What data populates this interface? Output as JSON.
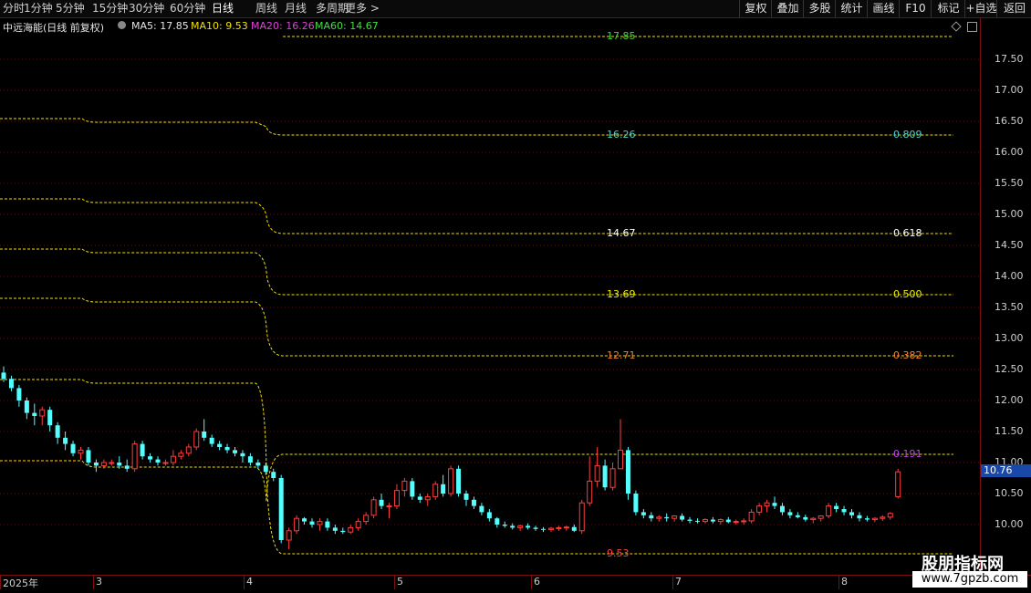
{
  "toolbar": {
    "periods": [
      "分时",
      "1分钟",
      "5分钟",
      "15分钟",
      "30分钟",
      "60分钟",
      "日线",
      "周线",
      "月线",
      "多周期",
      "更多 >"
    ],
    "active": "日线",
    "buttons": [
      "复权",
      "叠加",
      "多股",
      "统计",
      "画线",
      "F10",
      "+自选",
      "返回"
    ],
    "extra": "标记"
  },
  "info": {
    "stock": "中远海能(日线 前复权)",
    "ma5": "MA5: 17.85",
    "ma10": "MA10: 9.53",
    "ma20": "MA20: 16.26",
    "ma60": "MA60: 14.67",
    "ma_colors": {
      "ma5": "#e6e6e6",
      "ma10": "#f0e000",
      "ma20": "#e040e0",
      "ma60": "#40e040"
    }
  },
  "chart_data": {
    "type": "candlestick",
    "y_ticks": [
      "17.50",
      "17.00",
      "16.50",
      "16.00",
      "15.50",
      "15.00",
      "14.50",
      "14.00",
      "13.50",
      "13.00",
      "12.50",
      "12.00",
      "11.50",
      "11.00",
      "10.50",
      "10.00"
    ],
    "x_labels": [
      "2025年",
      "3",
      "4",
      "5",
      "6",
      "7",
      "8"
    ],
    "current_price": "10.76",
    "fib_levels": [
      {
        "price": "17.85",
        "ratio": "",
        "color": "#40d040"
      },
      {
        "price": "16.26",
        "ratio": "0.809",
        "color": "#50d0d0"
      },
      {
        "price": "14.67",
        "ratio": "0.618",
        "color": "#ffffff"
      },
      {
        "price": "13.69",
        "ratio": "0.500",
        "color": "#f0f000"
      },
      {
        "price": "12.71",
        "ratio": "0.382",
        "color": "#f08030"
      },
      {
        "price": "",
        "ratio": "0.191",
        "color": "#c040f0"
      },
      {
        "price": "9.53",
        "ratio": "",
        "color": "#ff4040"
      }
    ],
    "candles": [
      [
        12.45,
        12.55,
        12.3,
        12.35
      ],
      [
        12.35,
        12.4,
        12.15,
        12.2
      ],
      [
        12.2,
        12.25,
        11.9,
        12.0
      ],
      [
        12.0,
        12.05,
        11.7,
        11.8
      ],
      [
        11.8,
        11.95,
        11.6,
        11.75
      ],
      [
        11.75,
        11.9,
        11.6,
        11.85
      ],
      [
        11.85,
        11.9,
        11.5,
        11.6
      ],
      [
        11.6,
        11.65,
        11.3,
        11.4
      ],
      [
        11.4,
        11.5,
        11.2,
        11.3
      ],
      [
        11.3,
        11.35,
        11.1,
        11.15
      ],
      [
        11.15,
        11.25,
        11.05,
        11.2
      ],
      [
        11.2,
        11.25,
        10.95,
        11.0
      ],
      [
        11.0,
        11.05,
        10.85,
        10.95
      ],
      [
        10.95,
        11.05,
        10.9,
        11.0
      ],
      [
        11.0,
        11.05,
        10.95,
        11.0
      ],
      [
        11.0,
        11.1,
        10.9,
        10.95
      ],
      [
        10.95,
        11.05,
        10.85,
        10.9
      ],
      [
        10.9,
        11.35,
        10.85,
        11.3
      ],
      [
        11.3,
        11.35,
        11.05,
        11.1
      ],
      [
        11.1,
        11.15,
        11.0,
        11.05
      ],
      [
        11.05,
        11.1,
        10.95,
        11.0
      ],
      [
        11.0,
        11.05,
        10.95,
        11.0
      ],
      [
        11.0,
        11.2,
        10.95,
        11.1
      ],
      [
        11.1,
        11.2,
        11.05,
        11.15
      ],
      [
        11.15,
        11.3,
        11.1,
        11.25
      ],
      [
        11.25,
        11.55,
        11.2,
        11.5
      ],
      [
        11.5,
        11.7,
        11.35,
        11.4
      ],
      [
        11.4,
        11.45,
        11.25,
        11.3
      ],
      [
        11.3,
        11.35,
        11.2,
        11.25
      ],
      [
        11.25,
        11.3,
        11.15,
        11.2
      ],
      [
        11.2,
        11.25,
        11.1,
        11.15
      ],
      [
        11.15,
        11.2,
        11.0,
        11.1
      ],
      [
        11.1,
        11.15,
        10.95,
        11.0
      ],
      [
        11.0,
        11.05,
        10.9,
        10.95
      ],
      [
        10.95,
        11.0,
        10.8,
        10.85
      ],
      [
        10.85,
        10.9,
        10.7,
        10.75
      ],
      [
        10.75,
        10.8,
        9.7,
        9.75
      ],
      [
        9.75,
        9.95,
        9.6,
        9.9
      ],
      [
        9.9,
        10.15,
        9.85,
        10.1
      ],
      [
        10.1,
        10.12,
        10.0,
        10.05
      ],
      [
        10.05,
        10.1,
        9.95,
        10.0
      ],
      [
        10.0,
        10.1,
        9.9,
        10.05
      ],
      [
        10.05,
        10.1,
        9.9,
        9.95
      ],
      [
        9.95,
        10.0,
        9.85,
        9.9
      ],
      [
        9.9,
        9.95,
        9.85,
        9.88
      ],
      [
        9.88,
        10.0,
        9.85,
        9.95
      ],
      [
        9.95,
        10.1,
        9.9,
        10.05
      ],
      [
        10.05,
        10.2,
        10.0,
        10.15
      ],
      [
        10.15,
        10.45,
        10.1,
        10.4
      ],
      [
        10.4,
        10.5,
        10.25,
        10.3
      ],
      [
        10.3,
        10.35,
        10.1,
        10.3
      ],
      [
        10.3,
        10.65,
        10.25,
        10.55
      ],
      [
        10.55,
        10.75,
        10.45,
        10.7
      ],
      [
        10.7,
        10.75,
        10.4,
        10.45
      ],
      [
        10.45,
        10.5,
        10.35,
        10.4
      ],
      [
        10.4,
        10.5,
        10.3,
        10.45
      ],
      [
        10.45,
        10.7,
        10.4,
        10.65
      ],
      [
        10.65,
        10.8,
        10.45,
        10.5
      ],
      [
        10.5,
        10.95,
        10.45,
        10.9
      ],
      [
        10.9,
        10.95,
        10.45,
        10.5
      ],
      [
        10.5,
        10.55,
        10.3,
        10.4
      ],
      [
        10.4,
        10.45,
        10.25,
        10.3
      ],
      [
        10.3,
        10.35,
        10.15,
        10.2
      ],
      [
        10.2,
        10.25,
        10.05,
        10.1
      ],
      [
        10.1,
        10.12,
        9.95,
        10.0
      ],
      [
        10.0,
        10.05,
        9.95,
        9.98
      ],
      [
        9.98,
        10.02,
        9.92,
        9.95
      ],
      [
        9.95,
        10.0,
        9.9,
        9.98
      ],
      [
        9.98,
        10.02,
        9.92,
        9.95
      ],
      [
        9.95,
        9.98,
        9.9,
        9.93
      ],
      [
        9.93,
        9.96,
        9.88,
        9.92
      ],
      [
        9.92,
        9.96,
        9.88,
        9.94
      ],
      [
        9.94,
        9.98,
        9.9,
        9.95
      ],
      [
        9.95,
        9.98,
        9.9,
        9.96
      ],
      [
        9.96,
        10.0,
        9.88,
        9.9
      ],
      [
        9.9,
        10.4,
        9.85,
        10.35
      ],
      [
        10.35,
        11.1,
        10.3,
        10.7
      ],
      [
        10.7,
        11.25,
        10.6,
        10.95
      ],
      [
        10.95,
        11.05,
        10.55,
        10.6
      ],
      [
        10.6,
        11.0,
        10.55,
        10.9
      ],
      [
        10.9,
        11.7,
        10.9,
        11.2
      ],
      [
        11.2,
        11.25,
        10.4,
        10.5
      ],
      [
        10.5,
        10.55,
        10.15,
        10.2
      ],
      [
        10.2,
        10.25,
        10.1,
        10.15
      ],
      [
        10.15,
        10.2,
        10.05,
        10.1
      ],
      [
        10.1,
        10.15,
        10.05,
        10.12
      ],
      [
        10.12,
        10.18,
        10.05,
        10.1
      ],
      [
        10.1,
        10.15,
        10.05,
        10.14
      ],
      [
        10.14,
        10.18,
        10.05,
        10.08
      ],
      [
        10.08,
        10.12,
        10.02,
        10.06
      ],
      [
        10.06,
        10.1,
        10.02,
        10.05
      ],
      [
        10.05,
        10.1,
        10.02,
        10.08
      ],
      [
        10.08,
        10.12,
        10.02,
        10.05
      ],
      [
        10.05,
        10.1,
        10.0,
        10.08
      ],
      [
        10.08,
        10.12,
        10.02,
        10.04
      ],
      [
        10.04,
        10.08,
        10.0,
        10.05
      ],
      [
        10.05,
        10.1,
        10.0,
        10.06
      ],
      [
        10.06,
        10.25,
        10.02,
        10.2
      ],
      [
        10.2,
        10.35,
        10.15,
        10.3
      ],
      [
        10.3,
        10.4,
        10.2,
        10.35
      ],
      [
        10.35,
        10.45,
        10.25,
        10.3
      ],
      [
        10.3,
        10.35,
        10.15,
        10.2
      ],
      [
        10.2,
        10.25,
        10.1,
        10.15
      ],
      [
        10.15,
        10.2,
        10.1,
        10.12
      ],
      [
        10.12,
        10.16,
        10.05,
        10.08
      ],
      [
        10.08,
        10.12,
        10.02,
        10.1
      ],
      [
        10.1,
        10.15,
        10.05,
        10.14
      ],
      [
        10.14,
        10.35,
        10.1,
        10.3
      ],
      [
        10.3,
        10.35,
        10.2,
        10.25
      ],
      [
        10.25,
        10.3,
        10.15,
        10.2
      ],
      [
        10.2,
        10.25,
        10.1,
        10.15
      ],
      [
        10.15,
        10.2,
        10.05,
        10.1
      ],
      [
        10.1,
        10.14,
        10.05,
        10.08
      ],
      [
        10.08,
        10.12,
        10.04,
        10.1
      ],
      [
        10.1,
        10.15,
        10.06,
        10.12
      ],
      [
        10.12,
        10.2,
        10.08,
        10.18
      ],
      [
        10.45,
        10.9,
        10.42,
        10.85
      ]
    ]
  },
  "watermark": {
    "title": "股朋指标网",
    "url": "www.7gpzb.com"
  }
}
